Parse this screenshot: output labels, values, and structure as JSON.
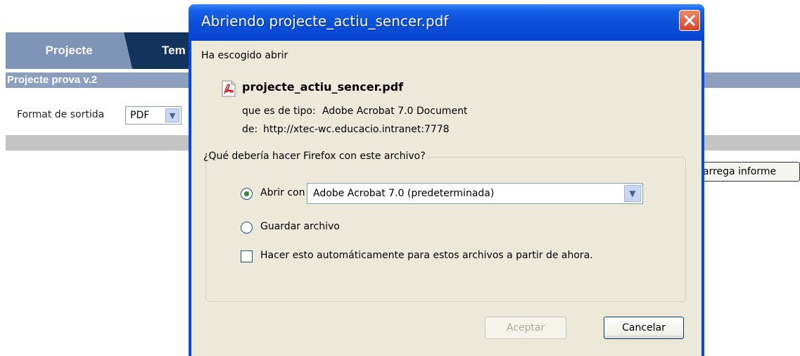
{
  "page": {
    "tabs": [
      {
        "label": "Projecte",
        "active": true
      },
      {
        "label": "Tem",
        "active": false
      }
    ],
    "project_title": "Projecte prova v.2",
    "format_label": "Format de sortida",
    "format_value": "PDF",
    "load_button": "arrega informe"
  },
  "dialog": {
    "title": "Abriendo projecte_actiu_sencer.pdf",
    "chosen_label": "Ha escogido abrir",
    "file_name": "projecte_actiu_sencer.pdf",
    "type_label": "que es de tipo:",
    "type_value": "Adobe Acrobat 7.0 Document",
    "from_label": "de:",
    "from_value": "http://xtec-wc.educacio.intranet:7778",
    "question": "¿Qué debería hacer Firefox con este archivo?",
    "open_with_label": "Abrir con",
    "open_with_selected": true,
    "open_with_app": "Adobe Acrobat 7.0 (predeterminada)",
    "save_label": "Guardar archivo",
    "save_selected": false,
    "auto_label": "Hacer esto automáticamente para estos archivos a partir de ahora.",
    "auto_checked": false,
    "accept_label": "Aceptar",
    "accept_enabled": false,
    "cancel_label": "Cancelar"
  },
  "colors": {
    "titlebar": "#0a4fd8",
    "dialog_body": "#ece9d8",
    "tab_active": "#7f95b7",
    "tab_inactive": "#12335c",
    "project_bar": "#8c9fbf"
  }
}
